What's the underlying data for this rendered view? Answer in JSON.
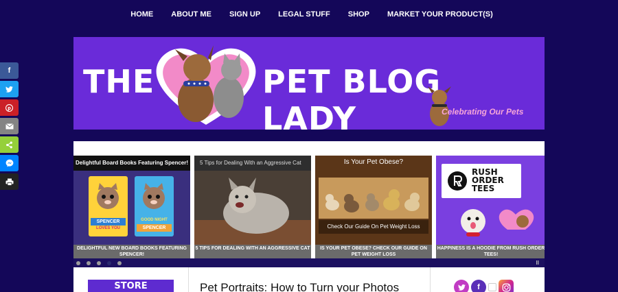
{
  "nav": {
    "items": [
      "HOME",
      "ABOUT ME",
      "SIGN UP",
      "LEGAL STUFF",
      "SHOP",
      "MARKET YOUR PRODUCT(S)"
    ]
  },
  "share_bar": {
    "icons": [
      "facebook-icon",
      "twitter-icon",
      "pinterest-icon",
      "email-icon",
      "share-icon",
      "messenger-icon",
      "print-icon"
    ]
  },
  "banner": {
    "title_left": "THE",
    "title_right": "PET BLOG LADY",
    "tagline": "Celebrating Our Pets"
  },
  "slider": {
    "slides": [
      {
        "image_title": "Delightful Board Books Featuring Spencer!",
        "book1_title": "SPENCER",
        "book1_subtitle": "LOVES YOU",
        "book2_title": "GOOD NIGHT",
        "book2_subtitle": "SPENCER",
        "caption": "DELIGHTFUL NEW BOARD BOOKS FEATURING SPENCER!"
      },
      {
        "image_title": "5 Tips for Dealing With an Aggressive Cat",
        "caption": "5 TIPS FOR DEALING WITH AN AGGRESSIVE CAT"
      },
      {
        "image_title": "Is Your Pet Obese?",
        "image_subtitle": "Check Our Guide On Pet Weight Loss",
        "caption": "IS YOUR PET OBESE? CHECK OUR GUIDE ON PET WEIGHT LOSS"
      },
      {
        "logo_text_1": "RUSH",
        "logo_text_2": "ORDER",
        "logo_text_3": "TEES",
        "caption": "HAPPINESS IS A HOODIE FROM RUSH ORDER TEES!"
      }
    ],
    "pause_label": "II"
  },
  "content": {
    "store_label": "STORE",
    "post_title": "Pet Portraits: How to Turn your Photos",
    "social_icons": [
      "twitter-icon",
      "facebook-icon",
      "broken-image-icon",
      "instagram-icon"
    ]
  },
  "colors": {
    "background": "#140759",
    "banner": "#6a2bd9",
    "caption_bar": "#6b6b6b"
  }
}
